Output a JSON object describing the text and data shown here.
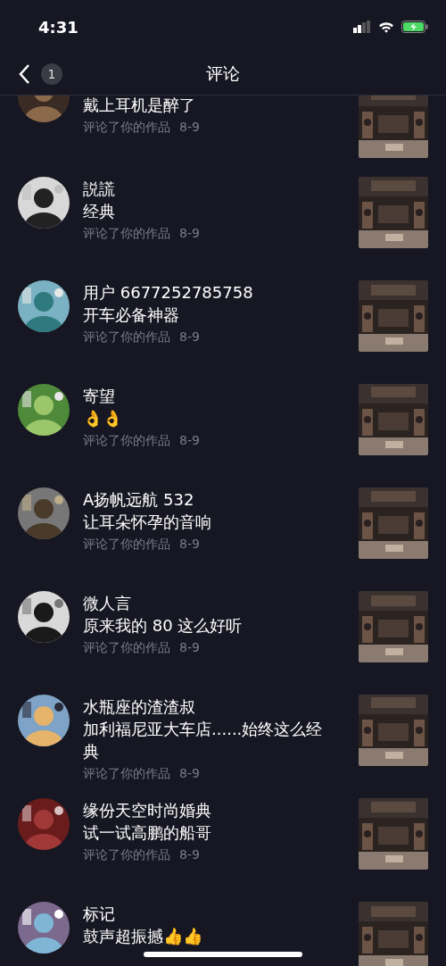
{
  "status_bar": {
    "time": "4:31"
  },
  "header": {
    "title": "评论",
    "badge": "1"
  },
  "notifications": [
    {
      "comment": "戴上耳机是醉了",
      "meta": "评论了你的作品",
      "date": "8-9",
      "partial": true
    },
    {
      "name": "説謊",
      "comment": "经典",
      "meta": "评论了你的作品",
      "date": "8-9"
    },
    {
      "name": "用户 6677252785758",
      "comment": "开车必备神器",
      "meta": "评论了你的作品",
      "date": "8-9"
    },
    {
      "name": "寄望",
      "comment": "👌👌",
      "meta": "评论了你的作品",
      "date": "8-9"
    },
    {
      "name": "A扬帆远航 532",
      "comment": "让耳朵怀孕的音响",
      "meta": "评论了你的作品",
      "date": "8-9"
    },
    {
      "name": "微人言",
      "comment": "原来我的 80 这么好听",
      "meta": "评论了你的作品",
      "date": "8-9"
    },
    {
      "name": "水瓶座的渣渣叔",
      "comment": "加利福尼亚大车店......始终这么经典",
      "meta": "评论了你的作品",
      "date": "8-9"
    },
    {
      "name": "缘份天空时尚婚典",
      "comment": "试一试高鹏的船哥",
      "meta": "评论了你的作品",
      "date": "8-9"
    },
    {
      "name": "标记",
      "comment": "鼓声超振撼👍👍"
    }
  ]
}
